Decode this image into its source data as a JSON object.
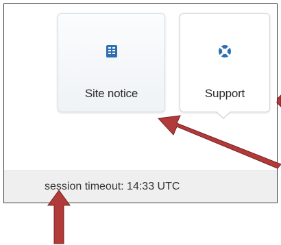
{
  "tiles": {
    "site_notice": {
      "label": "Site notice",
      "icon": "notice-board-icon"
    },
    "support": {
      "label": "Support",
      "icon": "lifebuoy-icon"
    }
  },
  "status": {
    "session_timeout": "session timeout: 14:33 UTC"
  },
  "colors": {
    "annotation_arrow": "#b13a3a",
    "icon_blue": "#2f6fb0"
  }
}
